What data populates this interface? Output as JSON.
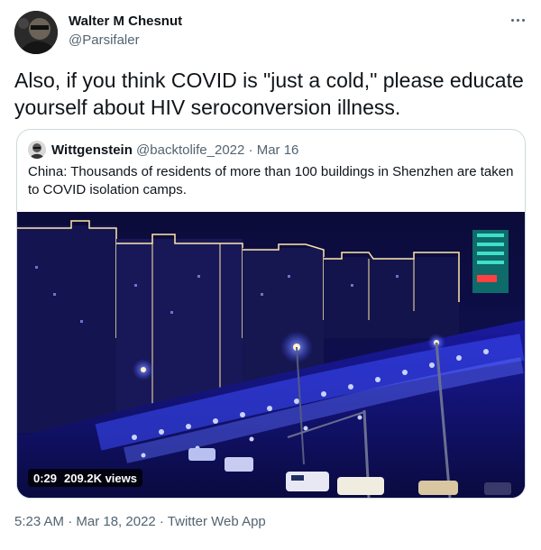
{
  "tweet": {
    "author_name": "Walter M Chesnut",
    "author_handle": "@Parsifaler",
    "text": "Also, if you think COVID is \"just a cold,\" please educate yourself about HIV seroconversion illness.",
    "footer": "5:23 AM · Mar 18, 2022 · Twitter Web App"
  },
  "quote": {
    "name": "Wittgenstein",
    "handle": "@backtolife_2022",
    "separator": " · ",
    "date": "Mar 16",
    "text": "China: Thousands of residents of more than 100 buildings in Shenzhen are taken to COVID isolation camps."
  },
  "video": {
    "duration": "0:29",
    "views": "209.2K views"
  },
  "colors": {
    "text": "#0f1419",
    "secondary": "#536471",
    "border": "#cfd9de",
    "police_light": "#3d4dff"
  },
  "icons": {
    "more": "more-horizontal-icon"
  }
}
